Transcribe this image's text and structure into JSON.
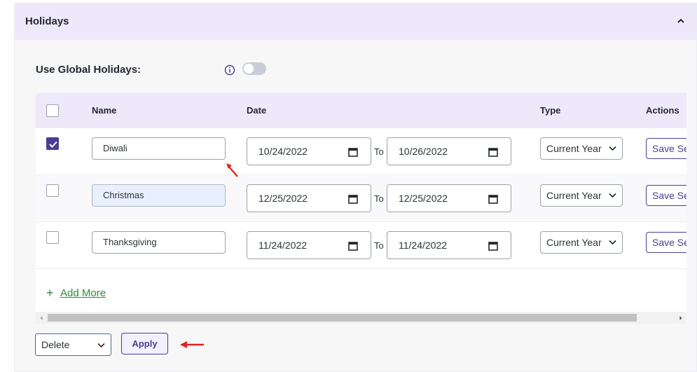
{
  "panel": {
    "title": "Holidays",
    "collapse_icon": "chevron-up-icon"
  },
  "global_holidays": {
    "label": "Use Global Holidays:",
    "info_icon": "info-icon",
    "enabled": false
  },
  "table": {
    "columns": {
      "name": "Name",
      "date": "Date",
      "type": "Type",
      "actions": "Actions"
    },
    "rows": [
      {
        "checked": true,
        "name": "Diwali",
        "from": "10/24/2022",
        "to_label": "To",
        "to": "10/26/2022",
        "type": "Current Year",
        "action": "Save Se"
      },
      {
        "checked": false,
        "name": "Christmas",
        "from": "12/25/2022",
        "to_label": "To",
        "to": "12/25/2022",
        "type": "Current Year",
        "action": "Save Se"
      },
      {
        "checked": false,
        "name": "Thanksgiving",
        "from": "11/24/2022",
        "to_label": "To",
        "to": "11/24/2022",
        "type": "Current Year",
        "action": "Save Se"
      }
    ],
    "add_more": {
      "icon": "plus-icon",
      "label": "Add More"
    }
  },
  "bulk": {
    "action": "Delete",
    "apply_label": "Apply"
  },
  "colors": {
    "accent": "#4a3e94",
    "header_bg": "#ede9fb",
    "add_more": "#2e8b3a",
    "annotation": "#e0201e"
  }
}
